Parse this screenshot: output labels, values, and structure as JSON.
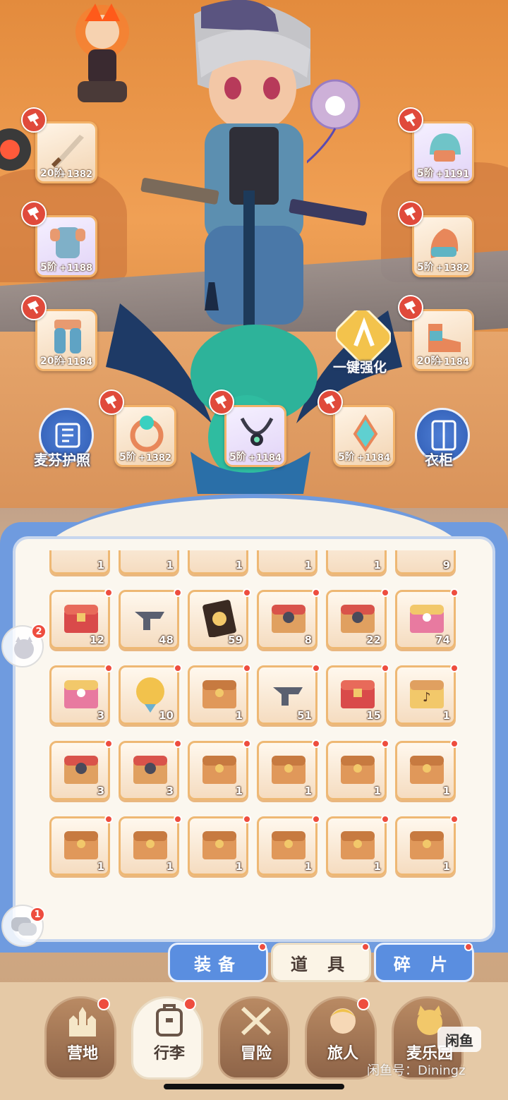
{
  "equipment": {
    "left": [
      {
        "name": "weapon",
        "level": "20阶",
        "bonus": "+1382"
      },
      {
        "name": "armor",
        "level": "5阶",
        "bonus": "+1188"
      },
      {
        "name": "pants",
        "level": "20阶",
        "bonus": "+1184"
      }
    ],
    "right": [
      {
        "name": "helmet",
        "level": "5阶",
        "bonus": "+1191"
      },
      {
        "name": "gloves",
        "level": "5阶",
        "bonus": "+1382"
      },
      {
        "name": "boots",
        "level": "20阶",
        "bonus": "+1184"
      }
    ],
    "accessories": [
      {
        "name": "ring",
        "level": "5阶",
        "bonus": "+1382"
      },
      {
        "name": "necklace",
        "level": "5阶",
        "bonus": "+1184"
      },
      {
        "name": "amulet",
        "level": "5阶",
        "bonus": "+1184"
      }
    ]
  },
  "buttons": {
    "passport": "麦芬护照",
    "wardrobe": "衣柜",
    "one_click_enhance": "一键强化"
  },
  "inventory": {
    "partial_row": [
      "1",
      "1",
      "1",
      "1",
      "1",
      "9"
    ],
    "rows": [
      [
        {
          "icon": "red-chest-icon",
          "count": "12"
        },
        {
          "icon": "anvil-icon",
          "count": "48"
        },
        {
          "icon": "card-icon",
          "count": "59"
        },
        {
          "icon": "chest-orb-icon",
          "count": "8"
        },
        {
          "icon": "chest-orb-icon",
          "count": "22"
        },
        {
          "icon": "pink-chest-icon",
          "count": "74"
        }
      ],
      [
        {
          "icon": "pink-chest-icon",
          "count": "3"
        },
        {
          "icon": "golden-orb-icon",
          "count": "10"
        },
        {
          "icon": "wood-chest-icon",
          "count": "1"
        },
        {
          "icon": "anvil-icon",
          "count": "51"
        },
        {
          "icon": "red-chest-icon",
          "count": "15"
        },
        {
          "icon": "music-chest-icon",
          "count": "1"
        }
      ],
      [
        {
          "icon": "chest-orb-icon",
          "count": "3"
        },
        {
          "icon": "chest-orb-icon",
          "count": "3"
        },
        {
          "icon": "wood-chest-icon",
          "count": "1"
        },
        {
          "icon": "wood-chest-icon",
          "count": "1"
        },
        {
          "icon": "wood-chest-icon",
          "count": "1"
        },
        {
          "icon": "wood-chest-icon",
          "count": "1"
        }
      ],
      [
        {
          "icon": "wood-chest-icon",
          "count": "1"
        },
        {
          "icon": "wood-chest-icon",
          "count": "1"
        },
        {
          "icon": "wood-chest-icon",
          "count": "1"
        },
        {
          "icon": "wood-chest-icon",
          "count": "1"
        },
        {
          "icon": "wood-chest-icon",
          "count": "1"
        },
        {
          "icon": "wood-chest-icon",
          "count": "1"
        }
      ]
    ]
  },
  "tabs": {
    "equipment": "装备",
    "items": "道 具",
    "fragments": "碎 片"
  },
  "nav": {
    "camp": "营地",
    "luggage": "行李",
    "adventure": "冒险",
    "traveler": "旅人",
    "muffin_music": "麦乐园"
  },
  "side": {
    "pet_badge": "2",
    "chat_badge": "1"
  },
  "watermark": {
    "logo": "闲鱼",
    "text": "闲鱼号：Diningz"
  },
  "colors": {
    "accent_blue": "#5a8ee0",
    "badge_red": "#ee4d3f",
    "item_border": "#eeb874"
  }
}
